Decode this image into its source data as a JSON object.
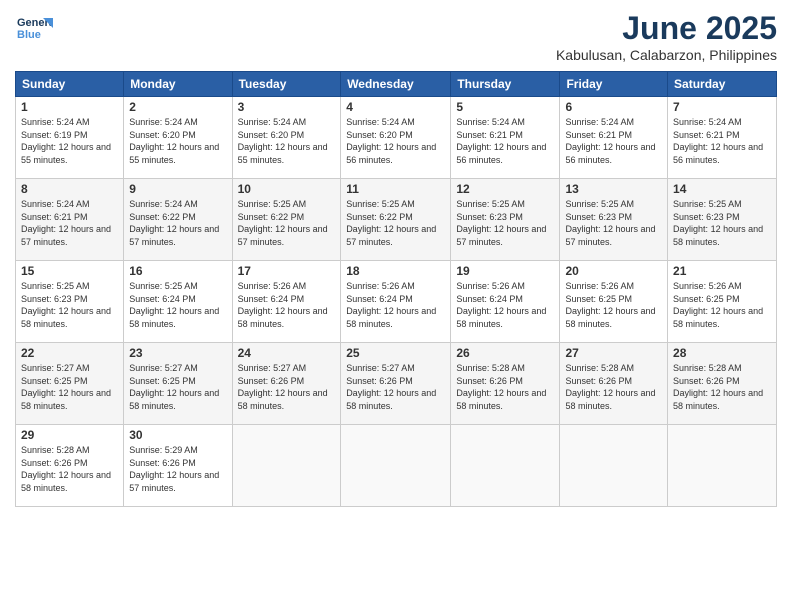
{
  "header": {
    "logo_line1": "General",
    "logo_line2": "Blue",
    "month": "June 2025",
    "location": "Kabulusan, Calabarzon, Philippines"
  },
  "weekdays": [
    "Sunday",
    "Monday",
    "Tuesday",
    "Wednesday",
    "Thursday",
    "Friday",
    "Saturday"
  ],
  "weeks": [
    [
      {
        "day": "1",
        "sunrise": "5:24 AM",
        "sunset": "6:19 PM",
        "daylight": "12 hours and 55 minutes."
      },
      {
        "day": "2",
        "sunrise": "5:24 AM",
        "sunset": "6:20 PM",
        "daylight": "12 hours and 55 minutes."
      },
      {
        "day": "3",
        "sunrise": "5:24 AM",
        "sunset": "6:20 PM",
        "daylight": "12 hours and 55 minutes."
      },
      {
        "day": "4",
        "sunrise": "5:24 AM",
        "sunset": "6:20 PM",
        "daylight": "12 hours and 56 minutes."
      },
      {
        "day": "5",
        "sunrise": "5:24 AM",
        "sunset": "6:21 PM",
        "daylight": "12 hours and 56 minutes."
      },
      {
        "day": "6",
        "sunrise": "5:24 AM",
        "sunset": "6:21 PM",
        "daylight": "12 hours and 56 minutes."
      },
      {
        "day": "7",
        "sunrise": "5:24 AM",
        "sunset": "6:21 PM",
        "daylight": "12 hours and 56 minutes."
      }
    ],
    [
      {
        "day": "8",
        "sunrise": "5:24 AM",
        "sunset": "6:21 PM",
        "daylight": "12 hours and 57 minutes."
      },
      {
        "day": "9",
        "sunrise": "5:24 AM",
        "sunset": "6:22 PM",
        "daylight": "12 hours and 57 minutes."
      },
      {
        "day": "10",
        "sunrise": "5:25 AM",
        "sunset": "6:22 PM",
        "daylight": "12 hours and 57 minutes."
      },
      {
        "day": "11",
        "sunrise": "5:25 AM",
        "sunset": "6:22 PM",
        "daylight": "12 hours and 57 minutes."
      },
      {
        "day": "12",
        "sunrise": "5:25 AM",
        "sunset": "6:23 PM",
        "daylight": "12 hours and 57 minutes."
      },
      {
        "day": "13",
        "sunrise": "5:25 AM",
        "sunset": "6:23 PM",
        "daylight": "12 hours and 57 minutes."
      },
      {
        "day": "14",
        "sunrise": "5:25 AM",
        "sunset": "6:23 PM",
        "daylight": "12 hours and 58 minutes."
      }
    ],
    [
      {
        "day": "15",
        "sunrise": "5:25 AM",
        "sunset": "6:23 PM",
        "daylight": "12 hours and 58 minutes."
      },
      {
        "day": "16",
        "sunrise": "5:25 AM",
        "sunset": "6:24 PM",
        "daylight": "12 hours and 58 minutes."
      },
      {
        "day": "17",
        "sunrise": "5:26 AM",
        "sunset": "6:24 PM",
        "daylight": "12 hours and 58 minutes."
      },
      {
        "day": "18",
        "sunrise": "5:26 AM",
        "sunset": "6:24 PM",
        "daylight": "12 hours and 58 minutes."
      },
      {
        "day": "19",
        "sunrise": "5:26 AM",
        "sunset": "6:24 PM",
        "daylight": "12 hours and 58 minutes."
      },
      {
        "day": "20",
        "sunrise": "5:26 AM",
        "sunset": "6:25 PM",
        "daylight": "12 hours and 58 minutes."
      },
      {
        "day": "21",
        "sunrise": "5:26 AM",
        "sunset": "6:25 PM",
        "daylight": "12 hours and 58 minutes."
      }
    ],
    [
      {
        "day": "22",
        "sunrise": "5:27 AM",
        "sunset": "6:25 PM",
        "daylight": "12 hours and 58 minutes."
      },
      {
        "day": "23",
        "sunrise": "5:27 AM",
        "sunset": "6:25 PM",
        "daylight": "12 hours and 58 minutes."
      },
      {
        "day": "24",
        "sunrise": "5:27 AM",
        "sunset": "6:26 PM",
        "daylight": "12 hours and 58 minutes."
      },
      {
        "day": "25",
        "sunrise": "5:27 AM",
        "sunset": "6:26 PM",
        "daylight": "12 hours and 58 minutes."
      },
      {
        "day": "26",
        "sunrise": "5:28 AM",
        "sunset": "6:26 PM",
        "daylight": "12 hours and 58 minutes."
      },
      {
        "day": "27",
        "sunrise": "5:28 AM",
        "sunset": "6:26 PM",
        "daylight": "12 hours and 58 minutes."
      },
      {
        "day": "28",
        "sunrise": "5:28 AM",
        "sunset": "6:26 PM",
        "daylight": "12 hours and 58 minutes."
      }
    ],
    [
      {
        "day": "29",
        "sunrise": "5:28 AM",
        "sunset": "6:26 PM",
        "daylight": "12 hours and 58 minutes."
      },
      {
        "day": "30",
        "sunrise": "5:29 AM",
        "sunset": "6:26 PM",
        "daylight": "12 hours and 57 minutes."
      },
      null,
      null,
      null,
      null,
      null
    ]
  ]
}
